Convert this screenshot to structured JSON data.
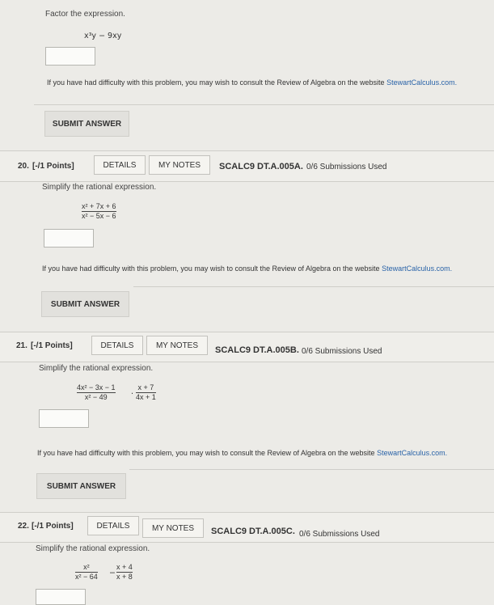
{
  "q19": {
    "prompt": "Factor the expression.",
    "expression": "x³y − 9xy",
    "help_text": "If you have had difficulty with this problem, you may wish to consult the Review of Algebra on the website ",
    "help_link": "StewartCalculus.com.",
    "submit_label": "SUBMIT ANSWER"
  },
  "q20": {
    "number": "20.",
    "points": "[-/1 Points]",
    "details_label": "DETAILS",
    "mynotes_label": "MY NOTES",
    "code": "SCALC9 DT.A.005A.",
    "submissions": "0/6 Submissions Used",
    "prompt": "Simplify the rational expression.",
    "frac_num": "x² + 7x + 6",
    "frac_den": "x² − 5x − 6",
    "help_text": "If you have had difficulty with this problem, you may wish to consult the Review of Algebra on the website ",
    "help_link": "StewartCalculus.com.",
    "submit_label": "SUBMIT ANSWER"
  },
  "q21": {
    "number": "21.",
    "points": "[-/1 Points]",
    "details_label": "DETAILS",
    "mynotes_label": "MY NOTES",
    "code": "SCALC9 DT.A.005B.",
    "submissions": "0/6 Submissions Used",
    "prompt": "Simplify the rational expression.",
    "frac1_num": "4x² − 3x − 1",
    "frac1_den": "x² − 49",
    "operator": "·",
    "frac2_num": "x + 7",
    "frac2_den": "4x + 1",
    "help_text": "If you have had difficulty with this problem, you may wish to consult the Review of Algebra on the website ",
    "help_link": "StewartCalculus.com.",
    "submit_label": "SUBMIT ANSWER"
  },
  "q22": {
    "number": "22.",
    "points": "[-/1 Points]",
    "details_label": "DETAILS",
    "mynotes_label": "MY NOTES",
    "code": "SCALC9 DT.A.005C.",
    "submissions": "0/6 Submissions Used",
    "prompt": "Simplify the rational expression.",
    "frac1_num": "x²",
    "frac1_den": "x² − 64",
    "operator": "−",
    "frac2_num": "x + 4",
    "frac2_den": "x + 8"
  },
  "colors": {
    "background": "#ecebe7",
    "link": "#2a63a8",
    "button": "#e2e1dd"
  }
}
